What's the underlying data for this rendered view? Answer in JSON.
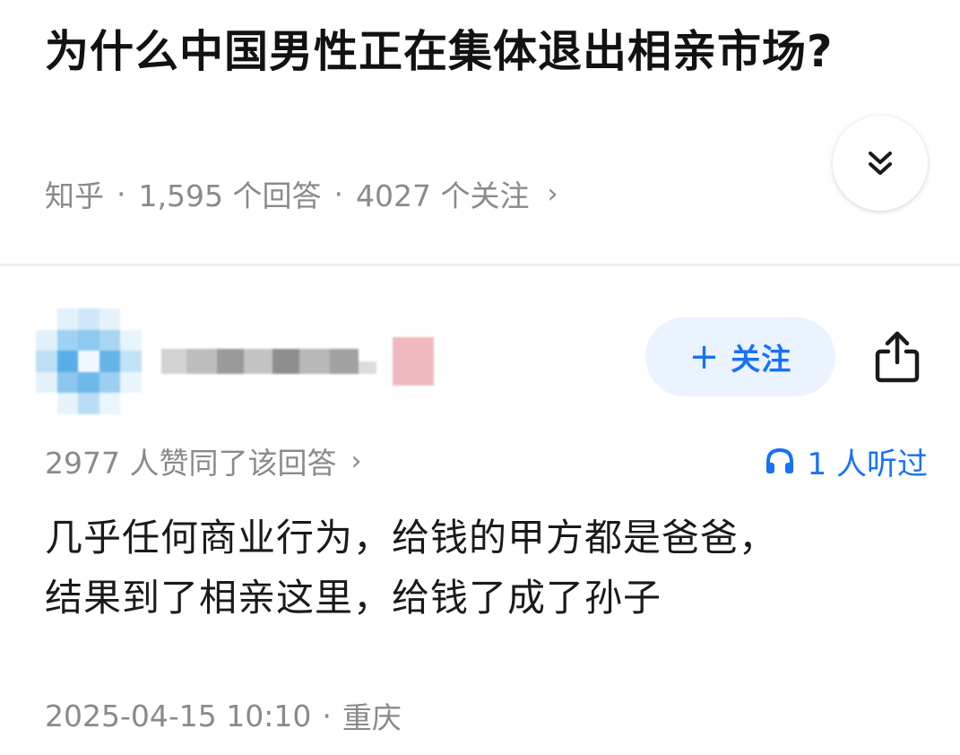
{
  "question": {
    "title": "为什么中国男性正在集体退出相亲市场?",
    "source": "知乎",
    "answer_count": "1,595 个回答",
    "follower_count": "4027 个关注",
    "separator": "·",
    "more_chevron": "›"
  },
  "answer": {
    "follow_button": {
      "plus": "+",
      "label": "关注"
    },
    "vote_text": "2977 人赞同了该回答",
    "vote_chevron": "›",
    "listen_text": "1 人听过",
    "content_lines": [
      "几乎任何商业行为，给钱的甲方都是爸爸，",
      "结果到了相亲这里，给钱了成了孙子"
    ],
    "datetime": "2025-04-15 10:10",
    "location": "重庆",
    "separator": "·"
  },
  "colors": {
    "accent": "#1772f6",
    "follow_bg": "#ebf3ff",
    "muted_text": "#8a8a8a",
    "title_text": "#121212"
  },
  "icons": {
    "expand": "double-chevron-down-icon",
    "share": "share-upload-icon",
    "listen": "headphones-icon"
  }
}
